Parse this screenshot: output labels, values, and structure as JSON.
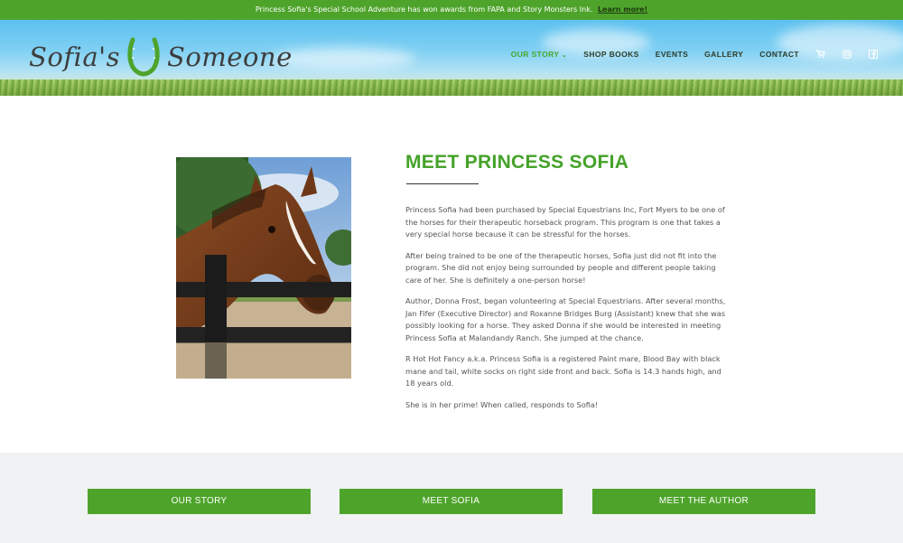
{
  "announcement": {
    "text": "Princess Sofia's Special School Adventure has won awards from FAPA and Story Monsters Ink.",
    "link_label": "Learn more!"
  },
  "logo": {
    "left": "Sofia's",
    "right": "Someone"
  },
  "nav": {
    "items": [
      {
        "label": "OUR STORY",
        "active": true,
        "dropdown": true
      },
      {
        "label": "SHOP BOOKS"
      },
      {
        "label": "EVENTS"
      },
      {
        "label": "GALLERY"
      },
      {
        "label": "CONTACT"
      }
    ],
    "icons": [
      "cart-icon",
      "instagram-icon",
      "facebook-icon"
    ],
    "active_color": "#47a72c"
  },
  "main": {
    "heading": "MEET PRINCESS SOFIA",
    "paragraphs": [
      "Princess Sofia had been purchased by Special Equestrians Inc, Fort Myers to be one of the horses for their therapeutic horseback program. This program is one that takes a very special horse because it can be stressful for the horses.",
      "After being trained to be one of the therapeutic horses, Sofia just did not fit into the program. She did not enjoy being surrounded by people and different people taking care of her. She is definitely a one-person horse!",
      "Author, Donna Frost, began volunteering at Special Equestrians. After several months, Jan Fifer (Executive Director) and Roxanne Bridges Burg (Assistant) knew that she was possibly looking for a horse. They asked Donna if she would be interested in meeting Princess Sofia at Malandandy Ranch. She jumped at the chance.",
      "R Hot Hot Fancy a.k.a. Princess Sofia is a registered Paint mare, Blood Bay with black mane and tail, white socks on right side front and back. Sofia is 14.3 hands high, and 18 years old.",
      "She is in her prime! When called, responds to Sofia!"
    ]
  },
  "footer_buttons": [
    "OUR STORY",
    "MEET SOFIA",
    "MEET THE AUTHOR"
  ],
  "colors": {
    "brand_green": "#4ea42b",
    "heading_green": "#45a22a",
    "band": "#f0f2f3"
  }
}
